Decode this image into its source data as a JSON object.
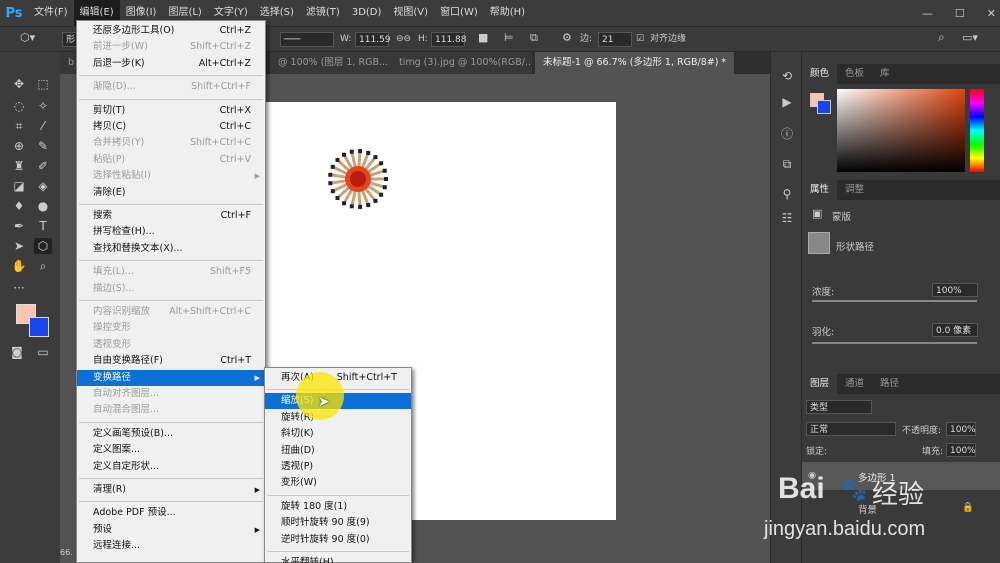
{
  "menubar": {
    "logo": "Ps",
    "items": [
      "文件(F)",
      "编辑(E)",
      "图像(I)",
      "图层(L)",
      "文字(Y)",
      "选择(S)",
      "滤镜(T)",
      "3D(D)",
      "视图(V)",
      "窗口(W)",
      "帮助(H)"
    ],
    "active_index": 1,
    "window_controls": [
      "—",
      "☐",
      "✕"
    ]
  },
  "options_bar": {
    "shape_mode": "形",
    "stroke": "───",
    "w_label": "W:",
    "w_value": "111.59",
    "h_label": "H:",
    "h_value": "111.88",
    "sides_label": "边:",
    "sides_value": "21",
    "align_edges": "对齐边缘"
  },
  "tabs": [
    {
      "label": "b"
    },
    {
      "label": "@ 100% (图层 1, RGB..."
    },
    {
      "label": "timg (3).jpg @ 100%(RGB/..."
    },
    {
      "label": "未标题-1 @ 66.7% (多边形 1, RGB/8#) *",
      "active": true
    }
  ],
  "status_text": "66.",
  "edit_menu": [
    {
      "label": "还原多边形工具(O)",
      "shortcut": "Ctrl+Z"
    },
    {
      "label": "前进一步(W)",
      "shortcut": "Shift+Ctrl+Z",
      "disabled": true
    },
    {
      "label": "后退一步(K)",
      "shortcut": "Alt+Ctrl+Z"
    },
    {
      "sep": true
    },
    {
      "label": "渐隐(D)...",
      "shortcut": "Shift+Ctrl+F",
      "disabled": true
    },
    {
      "sep": true
    },
    {
      "label": "剪切(T)",
      "shortcut": "Ctrl+X"
    },
    {
      "label": "拷贝(C)",
      "shortcut": "Ctrl+C"
    },
    {
      "label": "合并拷贝(Y)",
      "shortcut": "Shift+Ctrl+C",
      "disabled": true
    },
    {
      "label": "粘贴(P)",
      "shortcut": "Ctrl+V",
      "disabled": true
    },
    {
      "label": "选择性粘贴(I)",
      "submenu": true,
      "disabled": true
    },
    {
      "label": "清除(E)"
    },
    {
      "sep": true
    },
    {
      "label": "搜索",
      "shortcut": "Ctrl+F"
    },
    {
      "label": "拼写检查(H)..."
    },
    {
      "label": "查找和替换文本(X)..."
    },
    {
      "sep": true
    },
    {
      "label": "填充(L)...",
      "shortcut": "Shift+F5",
      "disabled": true
    },
    {
      "label": "描边(S)...",
      "disabled": true
    },
    {
      "sep": true
    },
    {
      "label": "内容识别缩放",
      "shortcut": "Alt+Shift+Ctrl+C",
      "disabled": true
    },
    {
      "label": "操控变形",
      "disabled": true
    },
    {
      "label": "透视变形",
      "disabled": true
    },
    {
      "label": "自由变换路径(F)",
      "shortcut": "Ctrl+T"
    },
    {
      "label": "变换路径",
      "submenu": true,
      "highlight": true
    },
    {
      "label": "自动对齐图层...",
      "disabled": true
    },
    {
      "label": "自动混合图层...",
      "disabled": true
    },
    {
      "sep": true
    },
    {
      "label": "定义画笔预设(B)..."
    },
    {
      "label": "定义图案..."
    },
    {
      "label": "定义自定形状..."
    },
    {
      "sep": true
    },
    {
      "label": "清理(R)",
      "submenu": true
    },
    {
      "sep": true
    },
    {
      "label": "Adobe PDF 预设..."
    },
    {
      "label": "预设",
      "submenu": true
    },
    {
      "label": "远程连接..."
    }
  ],
  "transform_submenu": [
    {
      "label": "再次(A)",
      "shortcut": "Shift+Ctrl+T"
    },
    {
      "sep": true
    },
    {
      "label": "缩放(S)",
      "highlight": true
    },
    {
      "label": "旋转(R)"
    },
    {
      "label": "斜切(K)"
    },
    {
      "label": "扭曲(D)"
    },
    {
      "label": "透视(P)"
    },
    {
      "label": "变形(W)"
    },
    {
      "sep": true
    },
    {
      "label": "旋转 180 度(1)"
    },
    {
      "label": "顺时针旋转 90 度(9)"
    },
    {
      "label": "逆时针旋转 90 度(0)"
    },
    {
      "sep": true
    },
    {
      "label": "水平翻转(H)"
    }
  ],
  "color_panel": {
    "tabs": [
      "颜色",
      "色板",
      "库"
    ],
    "fg_color": "#f9c5b0",
    "bg_color": "#1a44f0",
    "hue_color": "#e0450f"
  },
  "properties_panel": {
    "tabs": [
      "属性",
      "调整"
    ],
    "mask_label": "蒙版",
    "shape_path_label": "形状路径",
    "density_label": "浓度:",
    "density_value": "100%",
    "feather_label": "羽化:",
    "feather_value": "0.0 像素"
  },
  "layers_panel": {
    "tabs": [
      "图层",
      "通道",
      "路径"
    ],
    "filter_label": "类型",
    "blend_mode": "正常",
    "opacity_label": "不透明度:",
    "opacity_value": "100%",
    "lock_label": "锁定:",
    "fill_label": "填充:",
    "fill_value": "100%",
    "layers": [
      {
        "name": "多边形 1"
      },
      {
        "name": "背景"
      }
    ]
  },
  "watermark": {
    "logo": "Bai",
    "brand": "经验",
    "url": "jingyan.baidu.com"
  }
}
